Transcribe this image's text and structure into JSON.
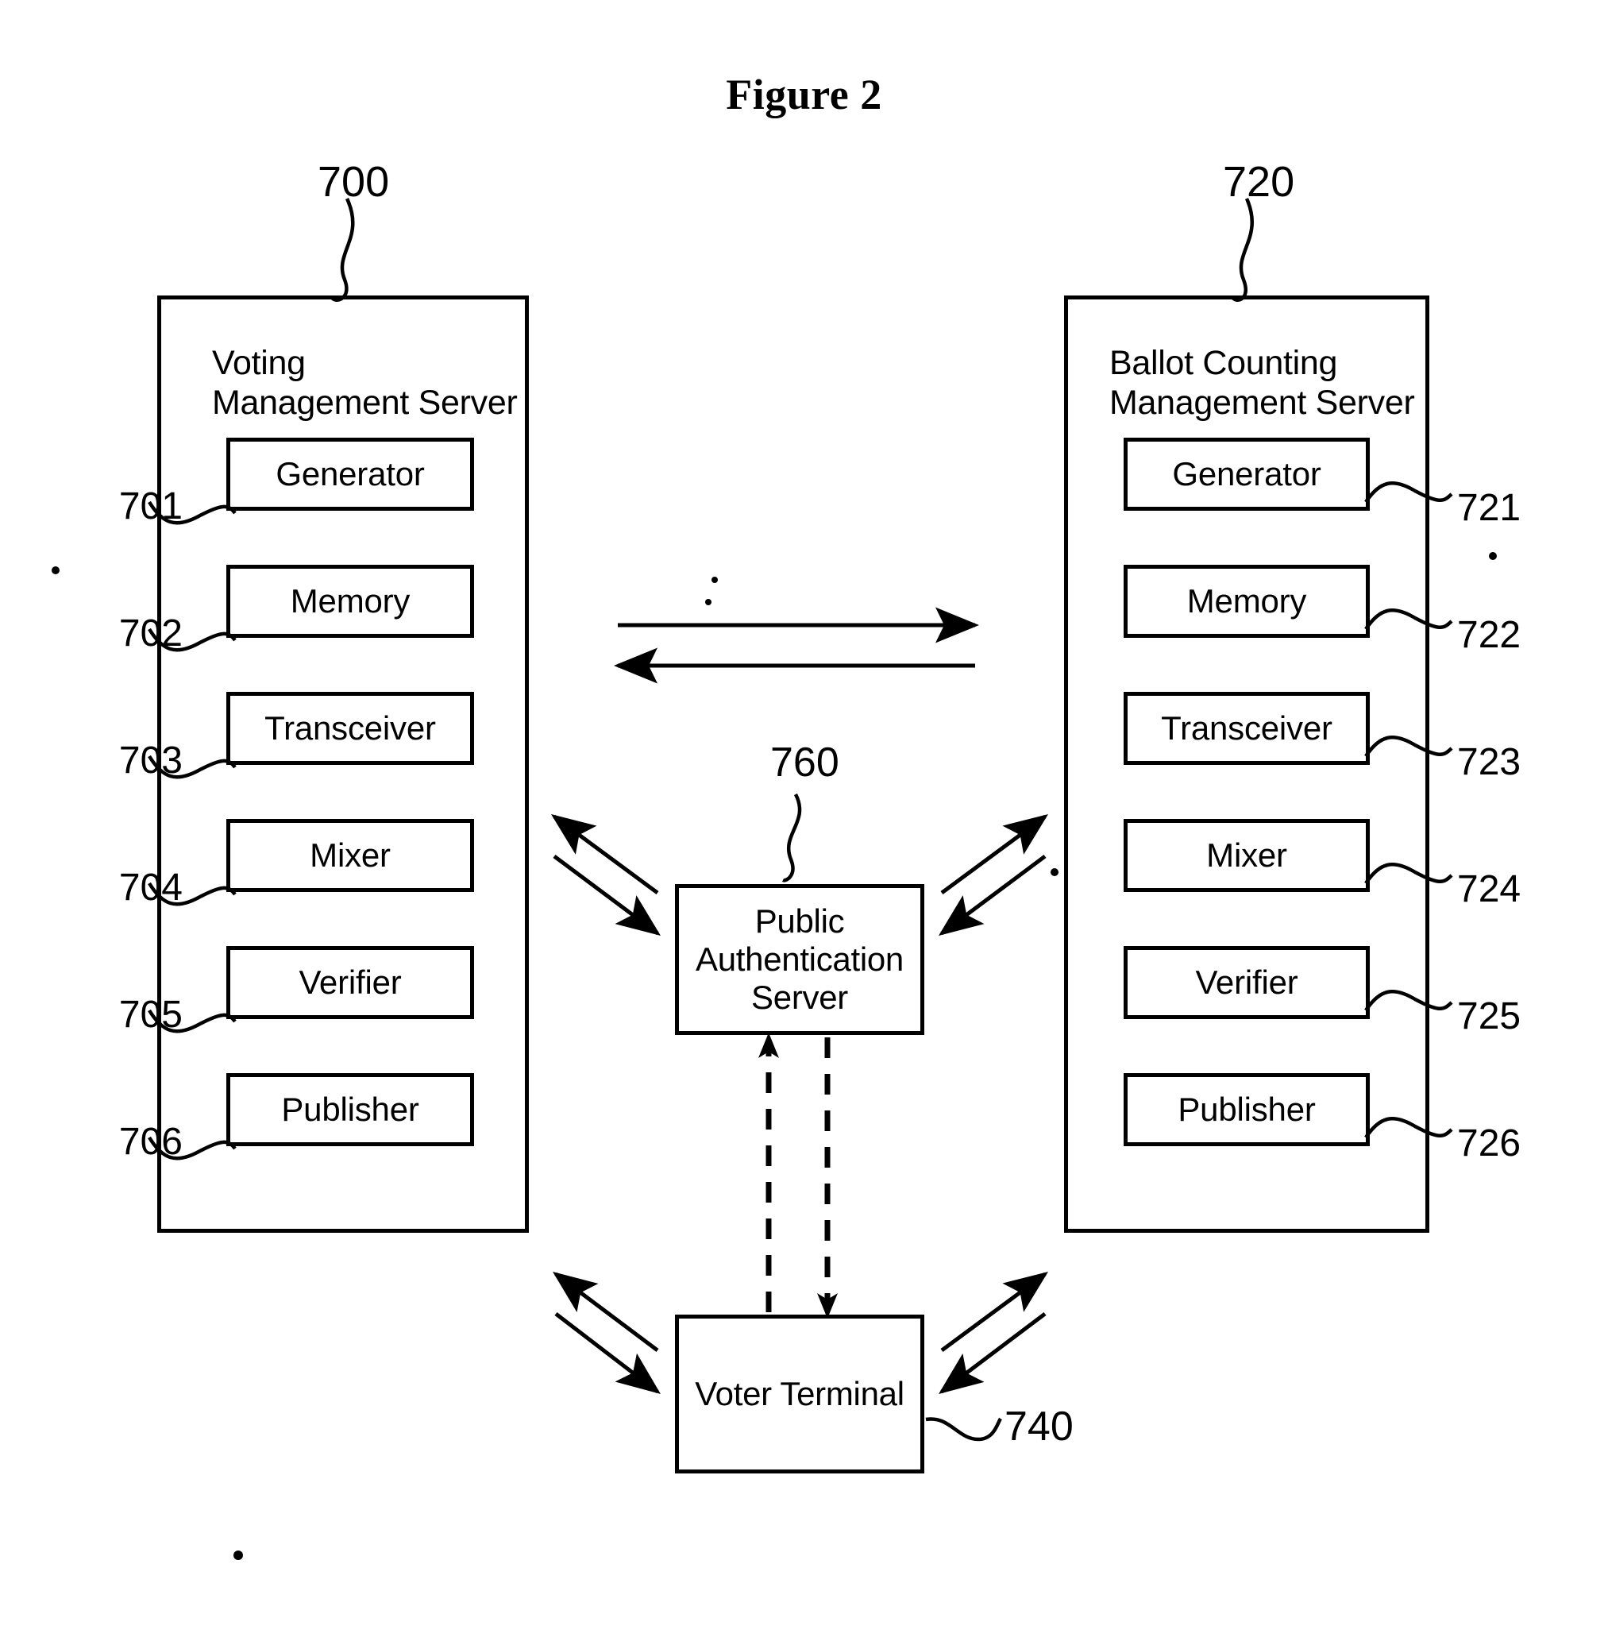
{
  "figure": {
    "title": "Figure 2"
  },
  "voting_server": {
    "ref": "700",
    "title": "Voting\nManagement Server",
    "components": [
      {
        "label": "Generator",
        "ref": "701"
      },
      {
        "label": "Memory",
        "ref": "702"
      },
      {
        "label": "Transceiver",
        "ref": "703"
      },
      {
        "label": "Mixer",
        "ref": "704"
      },
      {
        "label": "Verifier",
        "ref": "705"
      },
      {
        "label": "Publisher",
        "ref": "706"
      }
    ]
  },
  "ballot_server": {
    "ref": "720",
    "title": "Ballot Counting\nManagement Server",
    "components": [
      {
        "label": "Generator",
        "ref": "721"
      },
      {
        "label": "Memory",
        "ref": "722"
      },
      {
        "label": "Transceiver",
        "ref": "723"
      },
      {
        "label": "Mixer",
        "ref": "724"
      },
      {
        "label": "Verifier",
        "ref": "725"
      },
      {
        "label": "Publisher",
        "ref": "726"
      }
    ]
  },
  "auth_server": {
    "ref": "760",
    "title": "Public\nAuthentication\nServer"
  },
  "voter_terminal": {
    "ref": "740",
    "title": "Voter Terminal"
  },
  "colors": {
    "ink": "#000000",
    "paper": "#ffffff"
  }
}
